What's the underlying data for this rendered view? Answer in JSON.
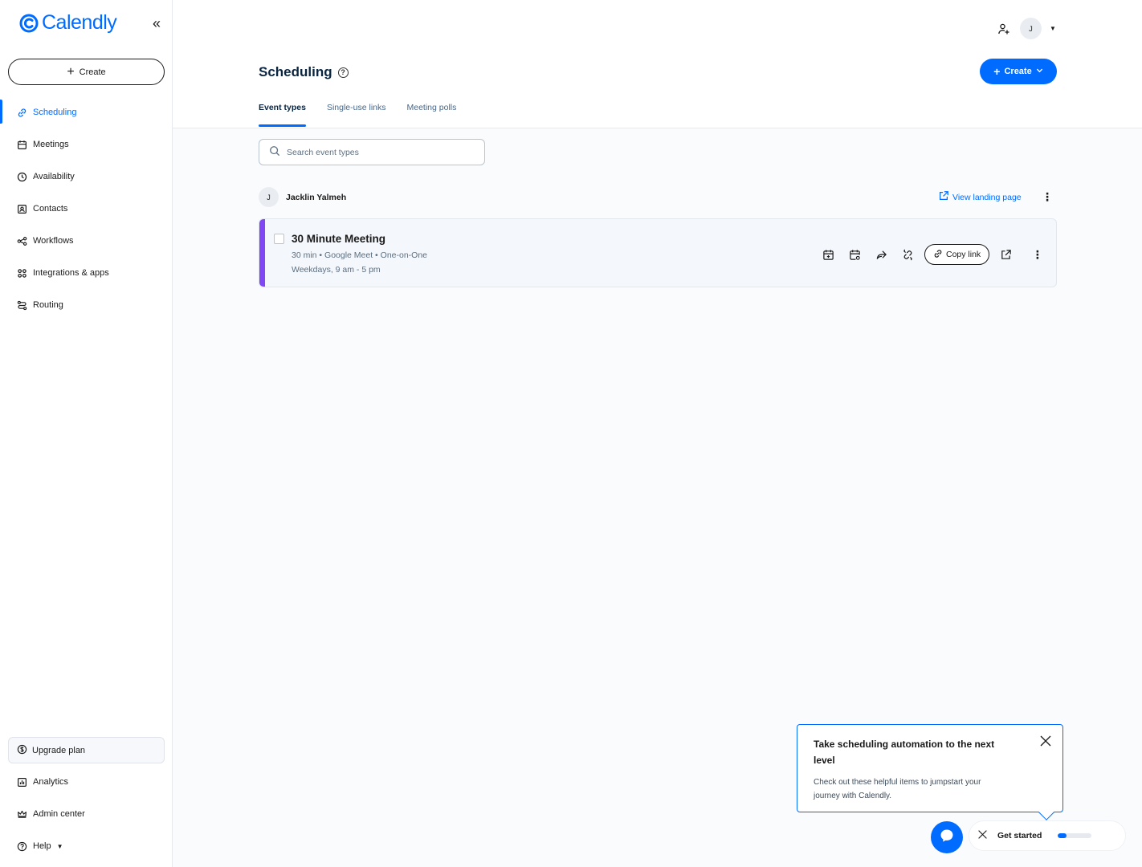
{
  "app": {
    "logo_text": "Calendly",
    "accent": "#006bff",
    "event_color": "#8247f5"
  },
  "sidebar": {
    "create_label": "Create",
    "items": [
      {
        "label": "Scheduling",
        "icon": "link-icon",
        "active": true
      },
      {
        "label": "Meetings",
        "icon": "calendar-icon"
      },
      {
        "label": "Availability",
        "icon": "clock-icon"
      },
      {
        "label": "Contacts",
        "icon": "contacts-icon"
      },
      {
        "label": "Workflows",
        "icon": "workflow-icon"
      },
      {
        "label": "Integrations & apps",
        "icon": "grid-icon"
      },
      {
        "label": "Routing",
        "icon": "routing-icon"
      }
    ],
    "bottom": {
      "upgrade": "Upgrade plan",
      "analytics": "Analytics",
      "admin": "Admin center",
      "help": "Help"
    }
  },
  "header": {
    "avatar_initial": "J",
    "title": "Scheduling",
    "create_label": "Create",
    "tabs": [
      "Event types",
      "Single-use links",
      "Meeting polls"
    ]
  },
  "main": {
    "search_placeholder": "Search event types",
    "owner": {
      "initial": "J",
      "name": "Jacklin Yalmeh"
    },
    "view_landing": "View landing page",
    "event": {
      "title": "30 Minute Meeting",
      "details": "30 min • Google Meet • One-on-One",
      "hours": "Weekdays, 9 am - 5 pm",
      "copy_link": "Copy link"
    }
  },
  "popup": {
    "title": "Take scheduling automation to the next level",
    "text": "Check out these helpful items to jumpstart your journey with Calendly."
  },
  "get_started": {
    "label": "Get started",
    "progress": 0.25
  }
}
